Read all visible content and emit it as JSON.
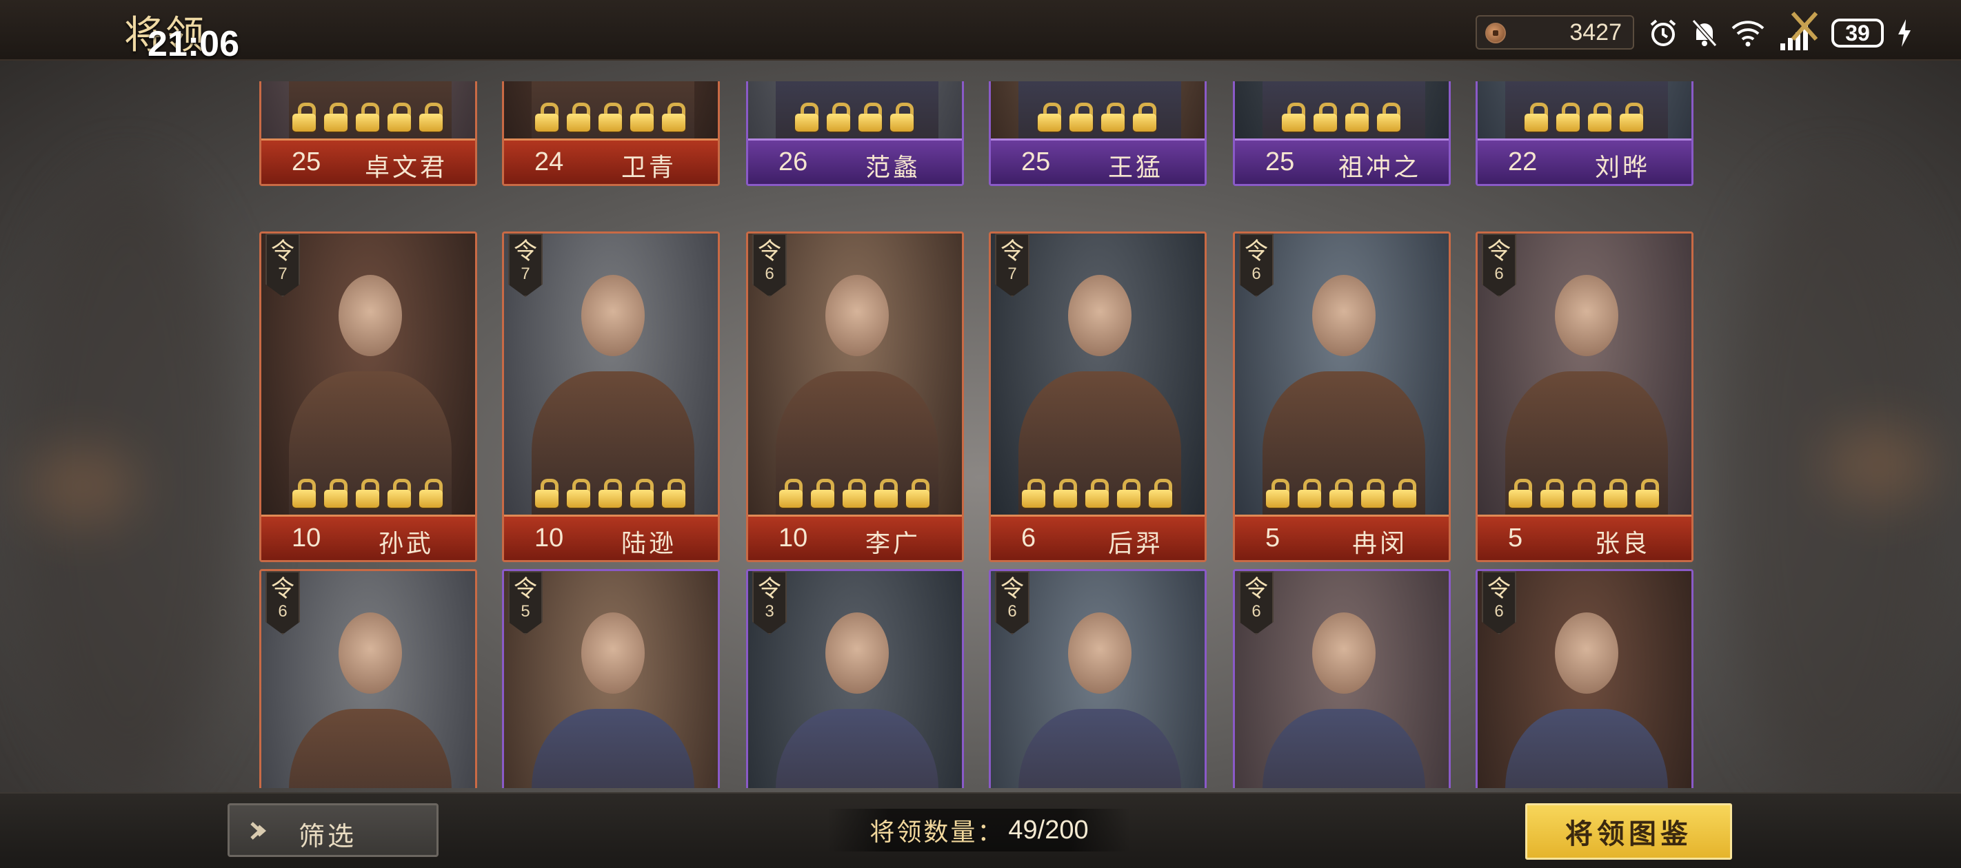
{
  "header": {
    "title": "将领",
    "clock": "21:06",
    "currency_value": "3427",
    "battery": "39"
  },
  "cards": [
    {
      "level": "25",
      "name": "卓文君",
      "rarity": "red",
      "locks": 5
    },
    {
      "level": "24",
      "name": "卫青",
      "rarity": "red",
      "locks": 5
    },
    {
      "level": "26",
      "name": "范蠡",
      "rarity": "purple",
      "locks": 4
    },
    {
      "level": "25",
      "name": "王猛",
      "rarity": "purple",
      "locks": 4
    },
    {
      "level": "25",
      "name": "祖冲之",
      "rarity": "purple",
      "locks": 4
    },
    {
      "level": "22",
      "name": "刘晔",
      "rarity": "purple",
      "locks": 4
    },
    {
      "level": "10",
      "name": "孙武",
      "rarity": "red",
      "locks": 5,
      "cmd_glyph": "令",
      "cmd": "7"
    },
    {
      "level": "10",
      "name": "陆逊",
      "rarity": "red",
      "locks": 5,
      "cmd_glyph": "令",
      "cmd": "7"
    },
    {
      "level": "10",
      "name": "李广",
      "rarity": "red",
      "locks": 5,
      "cmd_glyph": "令",
      "cmd": "6"
    },
    {
      "level": "6",
      "name": "后羿",
      "rarity": "red",
      "locks": 5,
      "cmd_glyph": "令",
      "cmd": "7"
    },
    {
      "level": "5",
      "name": "冉闵",
      "rarity": "red",
      "locks": 5,
      "cmd_glyph": "令",
      "cmd": "6"
    },
    {
      "level": "5",
      "name": "张良",
      "rarity": "red",
      "locks": 5,
      "cmd_glyph": "令",
      "cmd": "6"
    },
    {
      "rarity": "red",
      "cmd_glyph": "令",
      "cmd": "6"
    },
    {
      "rarity": "purple",
      "cmd_glyph": "令",
      "cmd": "5"
    },
    {
      "rarity": "purple",
      "cmd_glyph": "令",
      "cmd": "3"
    },
    {
      "rarity": "purple",
      "cmd_glyph": "令",
      "cmd": "6"
    },
    {
      "rarity": "purple",
      "cmd_glyph": "令",
      "cmd": "6"
    },
    {
      "rarity": "purple",
      "cmd_glyph": "令",
      "cmd": "6"
    }
  ],
  "footer": {
    "filter_label": "筛选",
    "count_label": "将领数量：",
    "count_value": "49/200",
    "codex_label": "将领图鉴"
  },
  "colors": {
    "red_card": "#b2361f",
    "purple_card": "#6a3b9c",
    "gold_button": "#f7d65a"
  }
}
